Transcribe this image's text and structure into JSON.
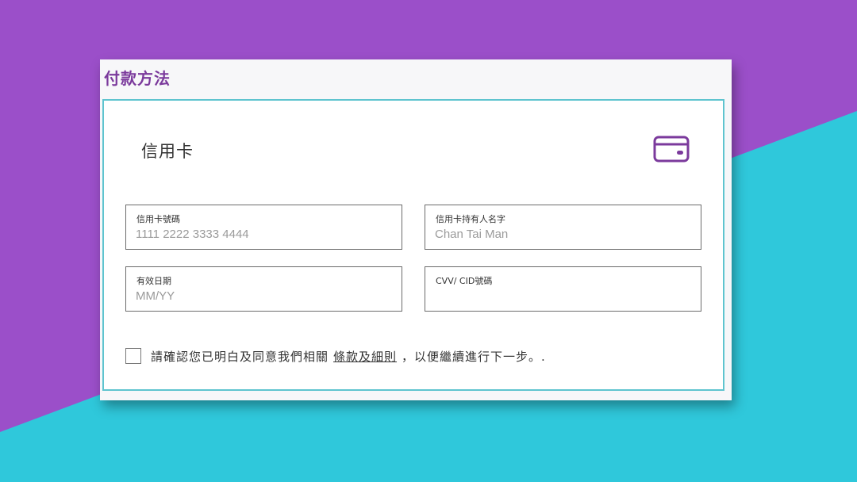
{
  "panel": {
    "title": "付款方法"
  },
  "card": {
    "heading": "信用卡",
    "icon": "credit-card-icon"
  },
  "fields": {
    "card_number": {
      "label": "信用卡號碼",
      "value": "",
      "placeholder": "1111 2222 3333 4444"
    },
    "cardholder_name": {
      "label": "信用卡持有人名字",
      "value": "",
      "placeholder": "Chan Tai Man"
    },
    "expiry": {
      "label": "有效日期",
      "value": "",
      "placeholder": "MM/YY"
    },
    "cvv": {
      "label": "CVV/ CID號碼",
      "value": "",
      "placeholder": ""
    }
  },
  "consent": {
    "checked": false,
    "text_before": "請確認您已明白及同意我們相關",
    "link_text": "條款及細則",
    "text_after": "，以便繼續進行下一步。."
  },
  "colors": {
    "background_purple": "#9b4fc9",
    "background_cyan": "#2fc8db",
    "accent_purple": "#7b3a9c",
    "card_border": "#5fc4cf"
  }
}
